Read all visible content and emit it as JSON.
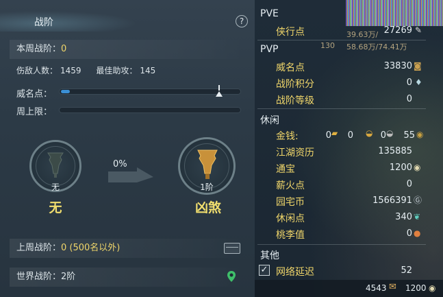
{
  "left": {
    "header_title": "战阶",
    "help_label": "?",
    "weekly_rank_label": "本周战阶：",
    "weekly_rank_value": "0",
    "defeated_label": "伤敌人数：",
    "defeated_value": "1459",
    "best_assist_label": "最佳助攻：",
    "best_assist_value": "145",
    "prestige_label": "威名点：",
    "prestige_progress": 0.05,
    "weekly_cap_label": "周上限：",
    "weekly_cap_progress": 0,
    "progress_pct": "0%",
    "current_rank": {
      "small_label": "无",
      "title": "无"
    },
    "next_rank": {
      "small_label": "1阶",
      "title": "凶煞"
    },
    "last_week_label": "上周战阶：",
    "last_week_value": "0 (500名以外)",
    "world_rank_label": "世界战阶：",
    "world_rank_value": "2阶"
  },
  "right": {
    "hud_bar1": "39.63万/",
    "hud_bar2": "58.68万/74.41万",
    "hud_level": "130",
    "pve": {
      "title": "PVE",
      "items": [
        {
          "label": "侠行点",
          "value": "27269"
        }
      ]
    },
    "pvp": {
      "title": "PVP",
      "items": [
        {
          "label": "威名点",
          "value": "33830"
        },
        {
          "label": "战阶积分",
          "value": "0"
        },
        {
          "label": "战阶等级",
          "value": "0"
        }
      ]
    },
    "leisure": {
      "title": "休闲",
      "money_label": "金钱:",
      "money_values": [
        "0",
        "0",
        "0",
        "55"
      ],
      "items": [
        {
          "label": "江湖资历",
          "value": "135885"
        },
        {
          "label": "通宝",
          "value": "1200"
        },
        {
          "label": "薪火点",
          "value": "0"
        },
        {
          "label": "园宅币",
          "value": "1566391"
        },
        {
          "label": "休闲点",
          "value": "340"
        },
        {
          "label": "桃李值",
          "value": "0"
        }
      ]
    },
    "other": {
      "title": "其他",
      "checkbox_mark": "✓",
      "latency_label": "网络延迟",
      "latency_value": "52"
    },
    "footer": {
      "left_value": "4543",
      "right_value": "1200"
    }
  }
}
